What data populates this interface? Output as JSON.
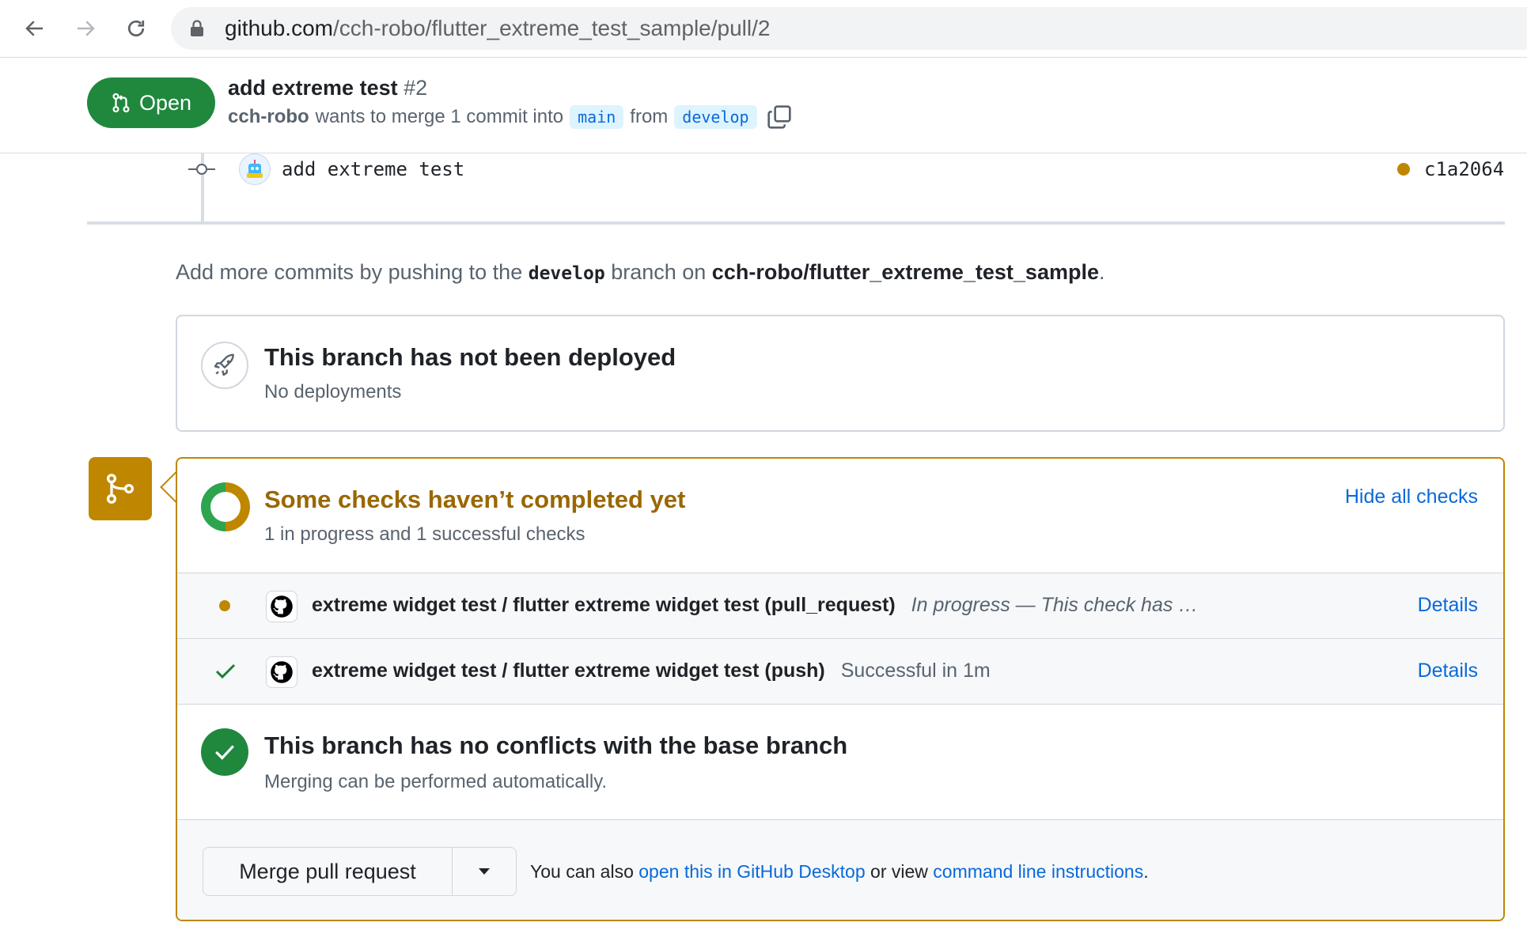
{
  "browser": {
    "url_host": "github.com",
    "url_path": "/cch-robo/flutter_extreme_test_sample/pull/2"
  },
  "header": {
    "state_label": "Open",
    "title": "add extreme test",
    "number": "#2",
    "author": "cch-robo",
    "merge_text": "wants to merge 1 commit into",
    "base_branch": "main",
    "from_text": "from",
    "head_branch": "develop"
  },
  "commit": {
    "message": "add extreme test",
    "sha": "c1a2064",
    "status_color": "#bf8700"
  },
  "push_note": {
    "prefix": "Add more commits by pushing to the",
    "branch": "develop",
    "middle": "branch on",
    "repo": "cch-robo/flutter_extreme_test_sample",
    "suffix": "."
  },
  "deployment": {
    "title": "This branch has not been deployed",
    "subtitle": "No deployments",
    "icon": "rocket-icon"
  },
  "checks": {
    "title": "Some checks haven’t completed yet",
    "subtitle": "1 in progress and 1 successful checks",
    "hide_label": "Hide all checks",
    "accent_color": "#bf8700",
    "success_color": "#2da44e",
    "items": [
      {
        "name": "extreme widget test / flutter extreme widget test (pull_request)",
        "description": "In progress — This check has …",
        "details_label": "Details",
        "status": "in-progress"
      },
      {
        "name": "extreme widget test / flutter extreme widget test (push)",
        "description": "Successful in 1m",
        "details_label": "Details",
        "status": "success"
      }
    ]
  },
  "conflicts": {
    "title": "This branch has no conflicts with the base branch",
    "subtitle": "Merging can be performed automatically."
  },
  "merge": {
    "button_label": "Merge pull request",
    "note_prefix": "You can also",
    "desktop_link": "open this in GitHub Desktop",
    "note_middle": "or view",
    "cli_link": "command line instructions",
    "note_suffix": "."
  }
}
